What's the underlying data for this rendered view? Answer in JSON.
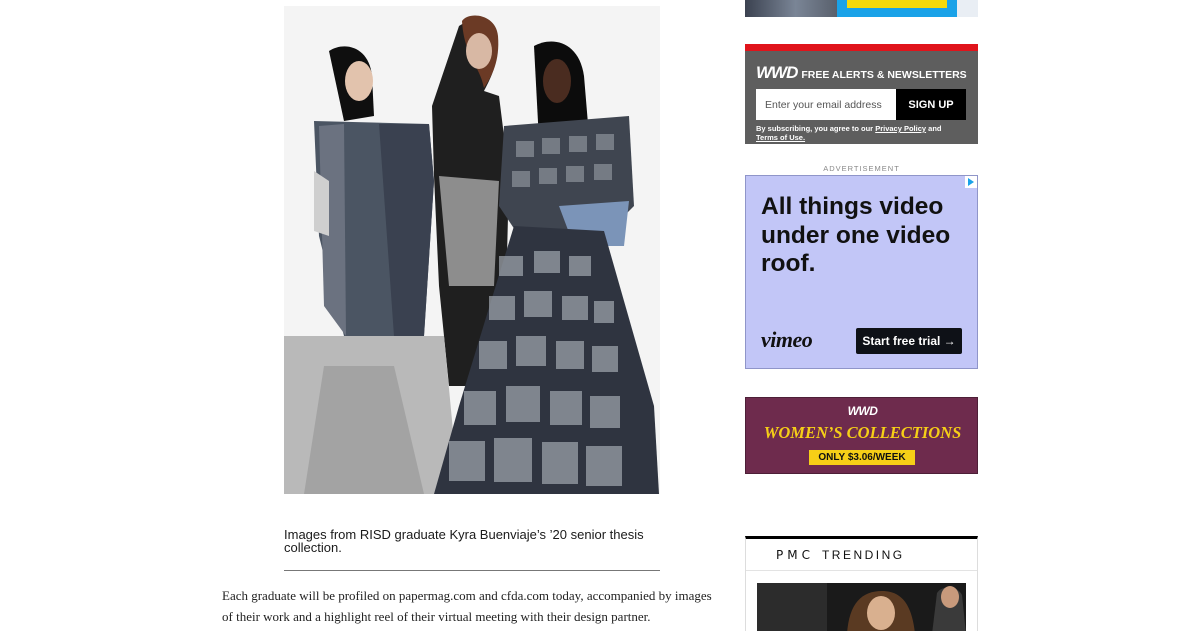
{
  "article": {
    "image_alt": "RISD senior thesis collection photo",
    "caption": "Images from RISD graduate Kyra Buenviaje’s ’20 senior thesis collection.",
    "body": "Each graduate will be profiled on papermag.com and cfda.com today, accompanied by images of their work and a highlight reel of their virtual meeting with their design partner."
  },
  "newsletter": {
    "logo": "WWD",
    "title": "FREE ALERTS & NEWSLETTERS",
    "email_placeholder": "Enter your email address",
    "signup_label": "SIGN UP",
    "legal_prefix": "By subscribing, you agree to our ",
    "privacy_link": "Privacy Policy",
    "legal_mid": " and ",
    "terms_link": "Terms of Use."
  },
  "ad_label": "ADVERTISEMENT",
  "vimeo_ad": {
    "headline": "All things video under one video roof.",
    "logo": "vimeo",
    "cta": "Start free trial →"
  },
  "wc_ad": {
    "logo": "WWD",
    "title": "WOMEN’S COLLECTIONS",
    "price": "ONLY $3.06/WEEK"
  },
  "pmc": {
    "logo": "PMC",
    "title": "TRENDING"
  },
  "colors": {
    "newsletter_bg": "#5e5e5e",
    "newsletter_accent": "#e0141b",
    "vimeo_bg": "#c2c6f7",
    "wc_bg": "#6e2b4d",
    "wc_gold": "#f6cf17"
  }
}
